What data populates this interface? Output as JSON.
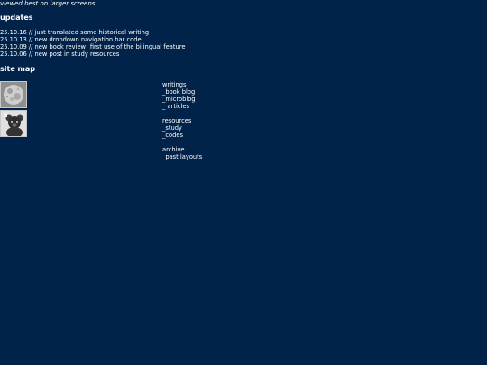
{
  "tagline": "viewed best on larger screens",
  "updates": {
    "title": "updates",
    "entries": [
      "25.10.16 // just translated some historical writing",
      "25.10.13 // new dropdown navigation bar code",
      "25.10.09 // new book review! first use of the bilingual feature",
      "25.10.06 // new post in study resources"
    ]
  },
  "sitemap": {
    "title": "site map",
    "groups": [
      {
        "items": [
          "writings",
          "_book blog",
          "_microblog",
          "_ articles"
        ]
      },
      {
        "items": [
          "resources",
          "_study",
          "_codes"
        ]
      },
      {
        "items": [
          "archive",
          "_past layouts"
        ]
      }
    ]
  },
  "colors": {
    "background": "#012249",
    "text": "#ffffff"
  },
  "icons": [
    "moon-photo-icon",
    "teddy-bear-photo-icon"
  ]
}
